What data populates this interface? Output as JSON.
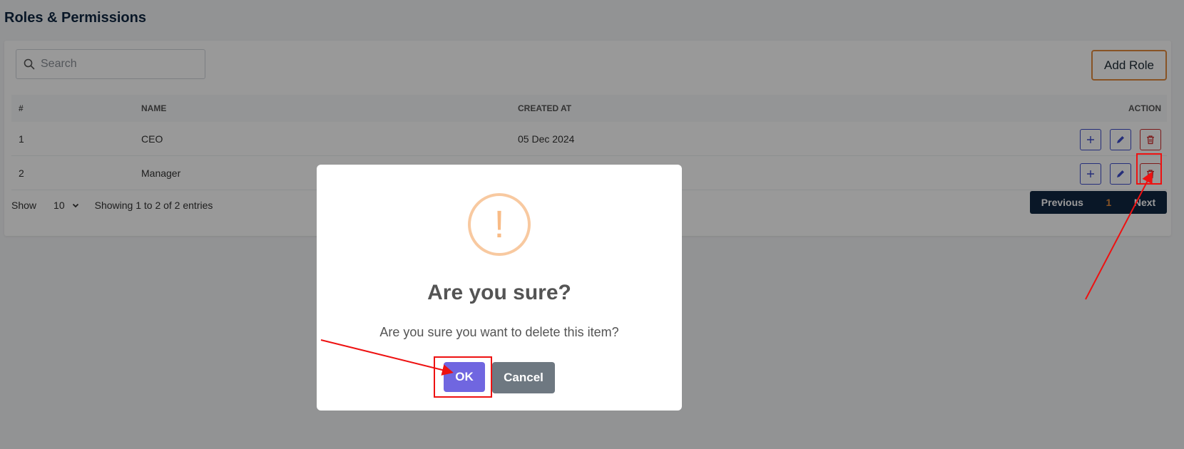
{
  "page": {
    "title": "Roles & Permissions"
  },
  "toolbar": {
    "search_placeholder": "Search",
    "add_role_label": "Add Role"
  },
  "table": {
    "columns": [
      "#",
      "NAME",
      "CREATED AT",
      "ACTION"
    ],
    "rows": [
      {
        "num": "1",
        "name": "CEO",
        "created_at": "05 Dec 2024"
      },
      {
        "num": "2",
        "name": "Manager",
        "created_at": ""
      }
    ]
  },
  "footer": {
    "show_label": "Show",
    "page_size": "10",
    "entries_info": "Showing 1 to 2 of 2 entries",
    "prev_label": "Previous",
    "current_page": "1",
    "next_label": "Next"
  },
  "dialog": {
    "icon": "!",
    "title": "Are you sure?",
    "message": "Are you sure you want to delete this item?",
    "ok_label": "OK",
    "cancel_label": "Cancel"
  },
  "icons": {
    "search": "search-icon",
    "add": "plus-icon",
    "edit": "pencil-icon",
    "delete": "trash-icon",
    "warning": "exclamation-icon",
    "dropdown": "chevron-down-icon"
  },
  "colors": {
    "brand_dark": "#0f2741",
    "accent_orange": "#e38b3f",
    "action_blue": "#3e4dcc",
    "danger_red": "#cf2a2a",
    "confirm_purple": "#7066e0",
    "cancel_gray": "#6e7881",
    "warning_orange": "#f8bb86",
    "annotation_red": "#ee1111"
  }
}
